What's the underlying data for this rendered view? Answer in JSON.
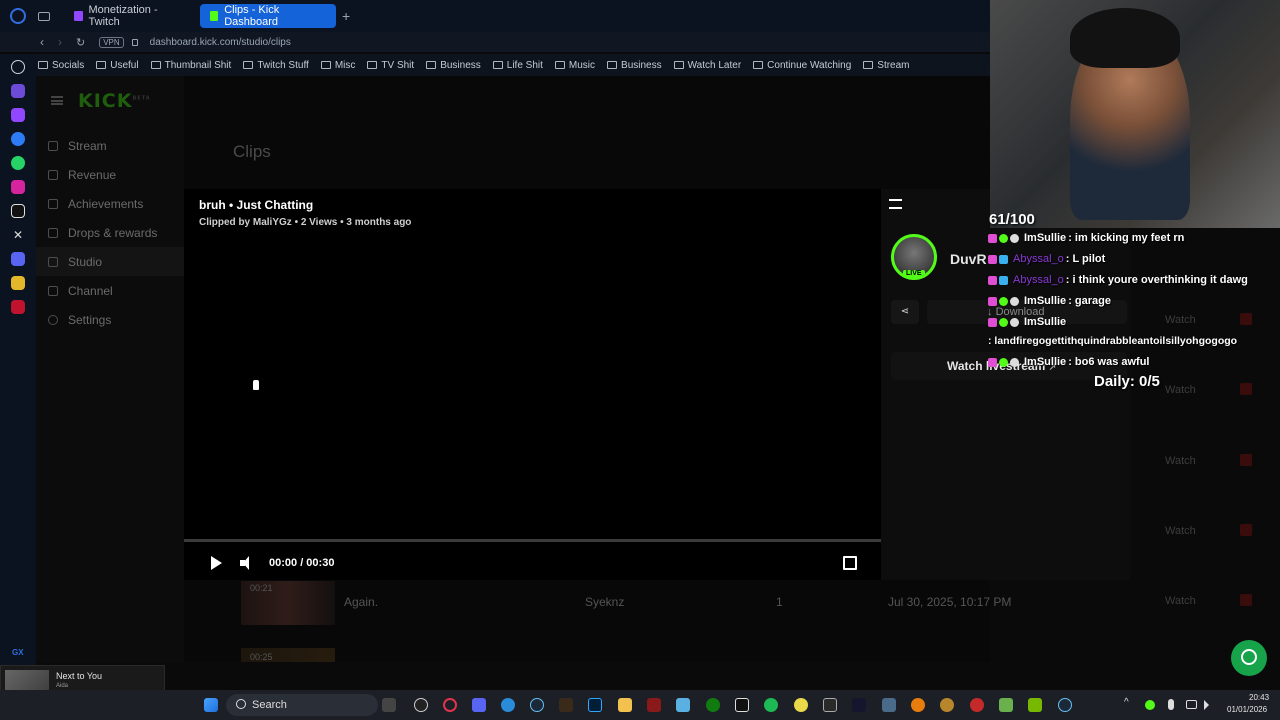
{
  "browser": {
    "tabs": [
      {
        "label": "Monetization - Twitch",
        "active": false
      },
      {
        "label": "Clips - Kick Dashboard",
        "active": true
      }
    ],
    "vpn_label": "VPN",
    "url": "dashboard.kick.com/studio/clips",
    "bookmarks": [
      "Socials",
      "Useful",
      "Thumbnail Shit",
      "Twitch Stuff",
      "Misc",
      "TV Shit",
      "Business",
      "Life Shit",
      "Music",
      "Business",
      "Watch Later",
      "Continue Watching",
      "Stream"
    ],
    "gx_label": "GX"
  },
  "kick": {
    "logo": "KICK",
    "logo_beta": "BETA",
    "nav": [
      "Stream",
      "Revenue",
      "Achievements",
      "Drops & rewards",
      "Studio",
      "Channel",
      "Settings"
    ],
    "active_nav": "Studio",
    "page_title": "Clips",
    "clip": {
      "title": "bruh • Just Chatting",
      "meta": "Clipped by MaliYGz • 2 Views • 3 months ago",
      "time": "00:00 / 00:30",
      "progress": 0
    },
    "drawer": {
      "channel": "DuvR",
      "live_badge": "LIVE",
      "download": "Download",
      "watch_livestream": "Watch livestream"
    },
    "row_actions": {
      "watch": "Watch"
    },
    "visible_row": {
      "duration": "00:21",
      "title": "Again.",
      "channel": "Syeknz",
      "views": "1",
      "date": "Jul 30, 2025, 10:17 PM"
    },
    "next_row_duration": "00:25"
  },
  "overlay": {
    "counter": "61/100",
    "daily": "Daily: 0/5",
    "chat": [
      {
        "user": "ImSullie",
        "text": ": im kicking my feet rn",
        "user_color": "#ffffff"
      },
      {
        "user": "Abyssal_o",
        "text": ": L pilot",
        "user_color": "#8a3ad6"
      },
      {
        "user": "Abyssal_o",
        "text": ": i think youre overthinking it dawg",
        "user_color": "#8a3ad6"
      },
      {
        "user": "ImSullie",
        "text": ": garage",
        "user_color": "#ffffff"
      },
      {
        "user": "ImSullie",
        "text": ": landfiregogettithquindrabbleantoilsillyohgogogo",
        "user_color": "#ffffff"
      },
      {
        "user": "ImSullie",
        "text": ": bo6 was awful",
        "user_color": "#ffffff"
      }
    ]
  },
  "media_widget": {
    "title": "Next to You",
    "artist": "Aida"
  },
  "taskbar": {
    "search": "Search",
    "time": "20:43",
    "date": "01/01/2026"
  },
  "colors": {
    "kick_green": "#53fc18",
    "accent_blue": "#1463d9",
    "delete_red": "#7a1414",
    "support_green": "#16a34a"
  }
}
